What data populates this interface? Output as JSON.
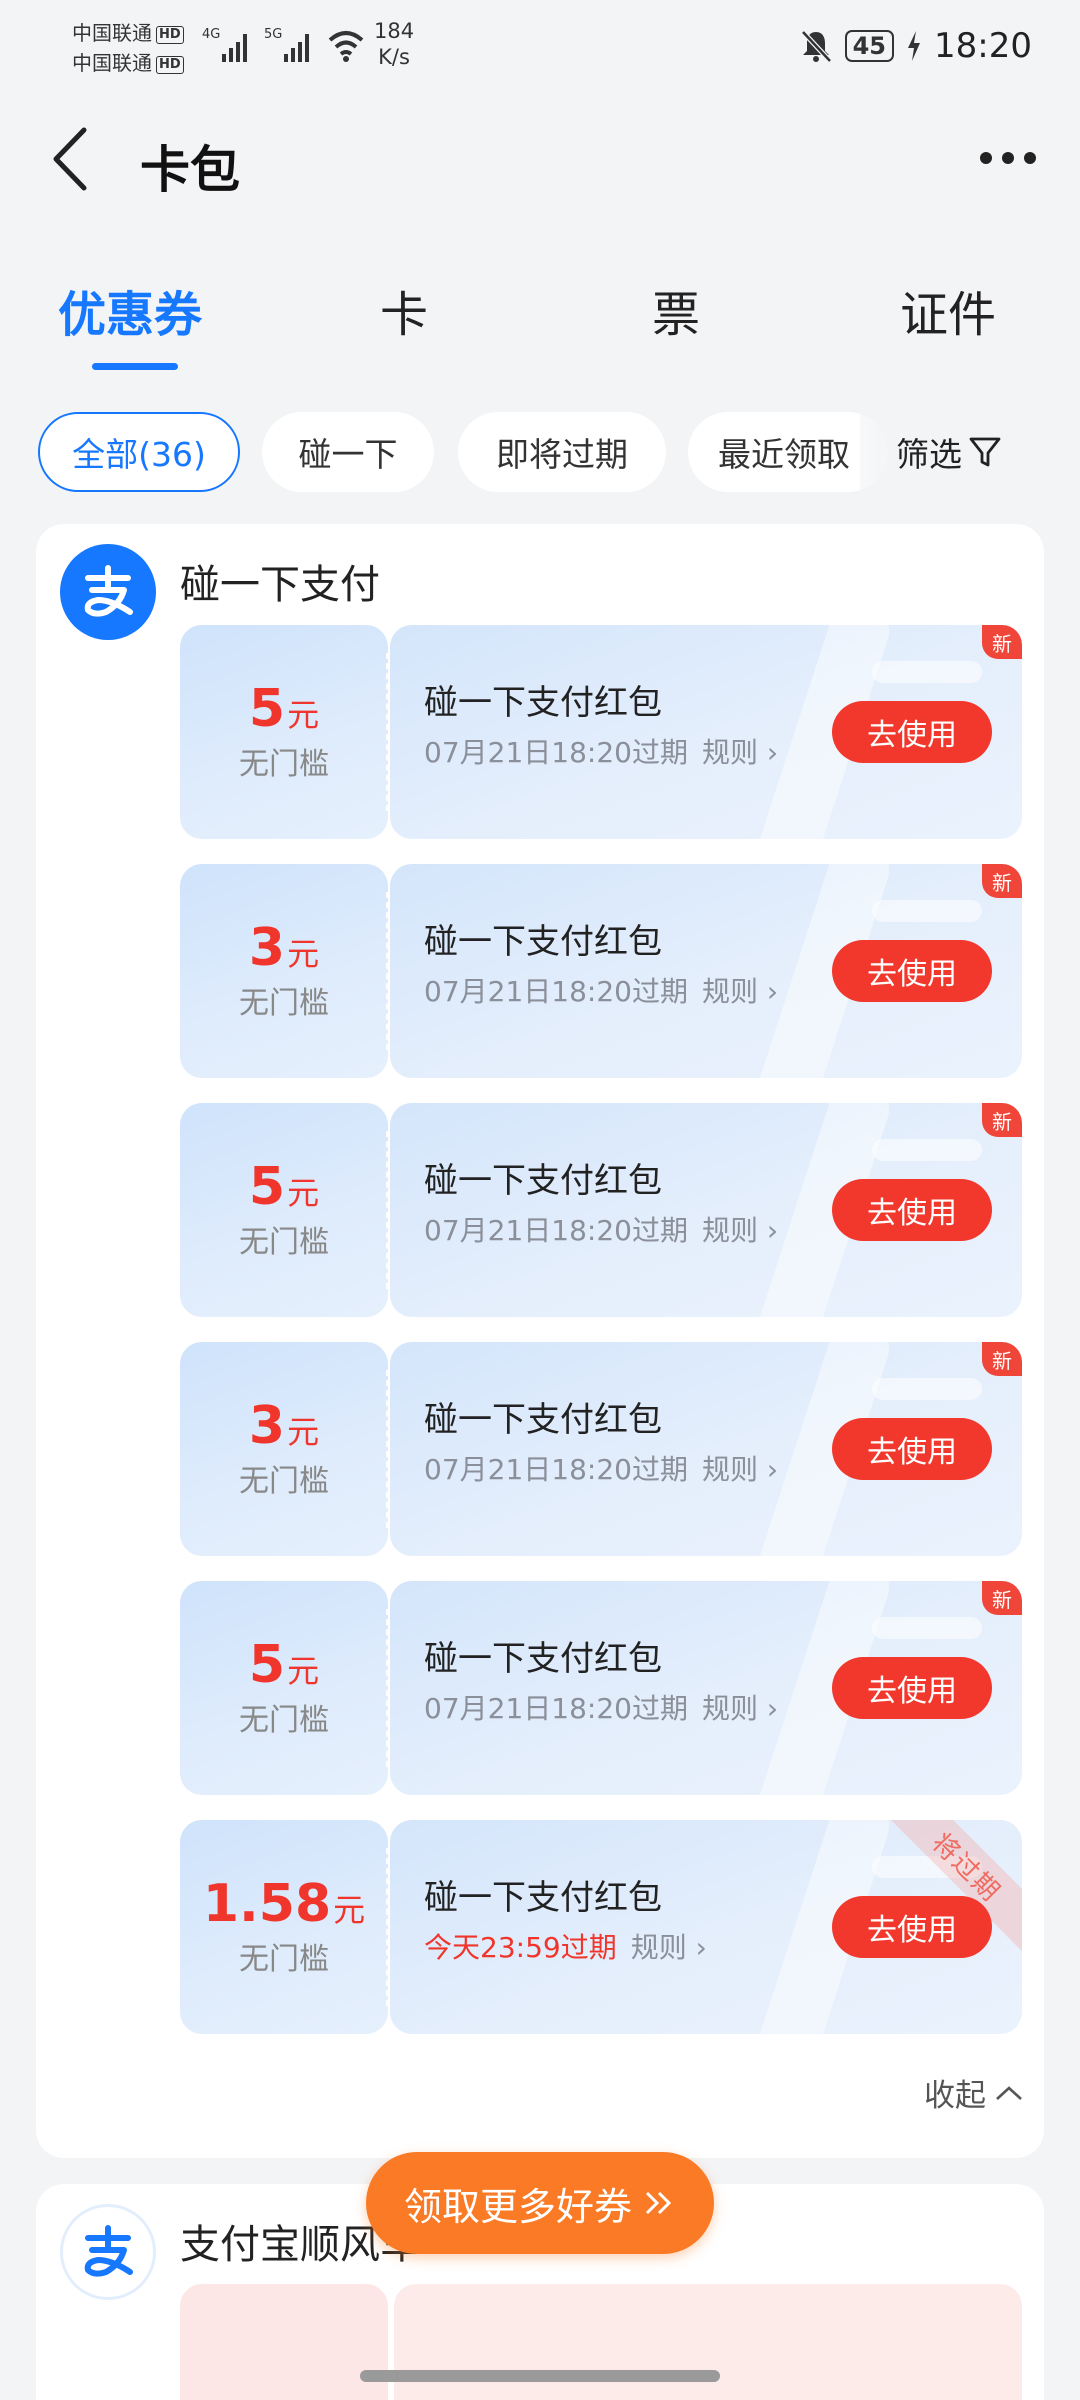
{
  "status_bar": {
    "carrier1": "中国联通",
    "carrier2": "中国联通",
    "hd": "HD",
    "net1": "4G",
    "net2": "5G",
    "speed_value": "184",
    "speed_unit": "K/s",
    "battery": "45",
    "time": "18:20"
  },
  "header": {
    "title": "卡包"
  },
  "tabs": [
    {
      "label": "优惠券",
      "active": true
    },
    {
      "label": "卡",
      "active": false
    },
    {
      "label": "票",
      "active": false
    },
    {
      "label": "证件",
      "active": false
    }
  ],
  "filters": {
    "chips": [
      "全部(36)",
      "碰一下",
      "即将过期",
      "最近领取"
    ],
    "filter_label": "筛选"
  },
  "groups": [
    {
      "name": "碰一下支付",
      "coupons": [
        {
          "amount": "5",
          "unit": "元",
          "threshold": "无门槛",
          "title": "碰一下支付红包",
          "expire": "07月21日18:20过期",
          "rule": "规则",
          "button": "去使用",
          "badge": "新"
        },
        {
          "amount": "3",
          "unit": "元",
          "threshold": "无门槛",
          "title": "碰一下支付红包",
          "expire": "07月21日18:20过期",
          "rule": "规则",
          "button": "去使用",
          "badge": "新"
        },
        {
          "amount": "5",
          "unit": "元",
          "threshold": "无门槛",
          "title": "碰一下支付红包",
          "expire": "07月21日18:20过期",
          "rule": "规则",
          "button": "去使用",
          "badge": "新"
        },
        {
          "amount": "3",
          "unit": "元",
          "threshold": "无门槛",
          "title": "碰一下支付红包",
          "expire": "07月21日18:20过期",
          "rule": "规则",
          "button": "去使用",
          "badge": "新"
        },
        {
          "amount": "5",
          "unit": "元",
          "threshold": "无门槛",
          "title": "碰一下支付红包",
          "expire": "07月21日18:20过期",
          "rule": "规则",
          "button": "去使用",
          "badge": "新"
        },
        {
          "amount": "1.58",
          "unit": "元",
          "threshold": "无门槛",
          "title": "碰一下支付红包",
          "expire": "今天23:59过期",
          "rule": "规则",
          "button": "去使用",
          "ribbon": "将过期"
        }
      ],
      "collapse": "收起"
    },
    {
      "name": "支付宝顺风车"
    }
  ],
  "float_button": "领取更多好券",
  "colors": {
    "accent": "#1677ff",
    "red": "#f2382c",
    "orange": "#fa7a25"
  }
}
